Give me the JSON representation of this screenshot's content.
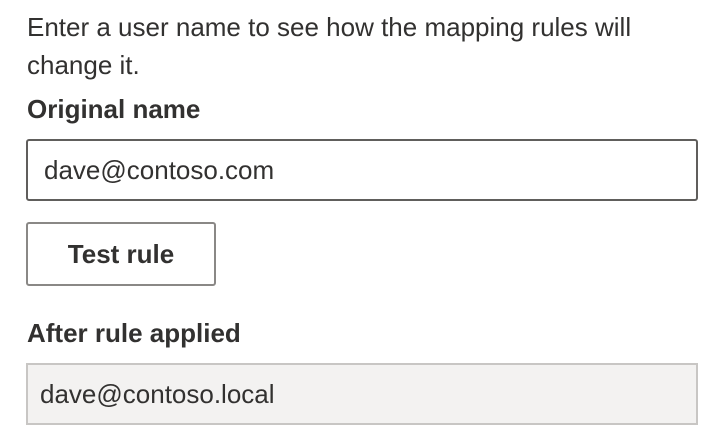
{
  "description": "Enter a user name to see how the mapping rules will change it.",
  "original_name": {
    "label": "Original name",
    "value": "dave@contoso.com"
  },
  "test_button_label": "Test rule",
  "after_rule": {
    "label": "After rule applied",
    "value": "dave@contoso.local"
  }
}
